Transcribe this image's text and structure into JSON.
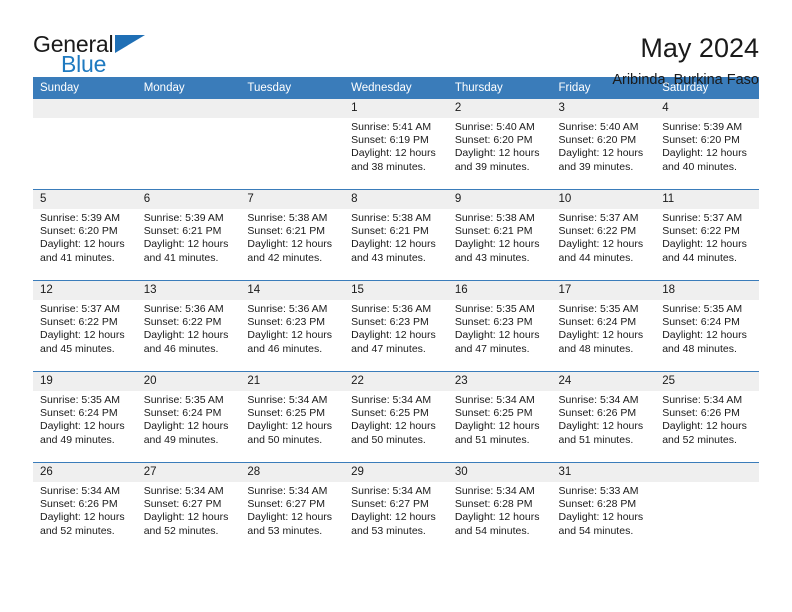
{
  "brand": {
    "name_part1": "General",
    "name_part2": "Blue",
    "triangle_icon": "triangle-icon",
    "colors": {
      "blue": "#1f7ac0",
      "dark": "#1a1a1a"
    }
  },
  "header": {
    "title": "May 2024",
    "subtitle": "Aribinda, Burkina Faso"
  },
  "calendar": {
    "accent_color": "#3a7cba",
    "daynum_band_color": "#efefef",
    "weekday_headers": [
      "Sunday",
      "Monday",
      "Tuesday",
      "Wednesday",
      "Thursday",
      "Friday",
      "Saturday"
    ],
    "weeks": [
      [
        {
          "day": "",
          "sunrise": "",
          "sunset": "",
          "daylight": "",
          "empty": true
        },
        {
          "day": "",
          "sunrise": "",
          "sunset": "",
          "daylight": "",
          "empty": true
        },
        {
          "day": "",
          "sunrise": "",
          "sunset": "",
          "daylight": "",
          "empty": true
        },
        {
          "day": "1",
          "sunrise": "Sunrise: 5:41 AM",
          "sunset": "Sunset: 6:19 PM",
          "daylight": "Daylight: 12 hours\nand 38 minutes."
        },
        {
          "day": "2",
          "sunrise": "Sunrise: 5:40 AM",
          "sunset": "Sunset: 6:20 PM",
          "daylight": "Daylight: 12 hours\nand 39 minutes."
        },
        {
          "day": "3",
          "sunrise": "Sunrise: 5:40 AM",
          "sunset": "Sunset: 6:20 PM",
          "daylight": "Daylight: 12 hours\nand 39 minutes."
        },
        {
          "day": "4",
          "sunrise": "Sunrise: 5:39 AM",
          "sunset": "Sunset: 6:20 PM",
          "daylight": "Daylight: 12 hours\nand 40 minutes."
        }
      ],
      [
        {
          "day": "5",
          "sunrise": "Sunrise: 5:39 AM",
          "sunset": "Sunset: 6:20 PM",
          "daylight": "Daylight: 12 hours\nand 41 minutes."
        },
        {
          "day": "6",
          "sunrise": "Sunrise: 5:39 AM",
          "sunset": "Sunset: 6:21 PM",
          "daylight": "Daylight: 12 hours\nand 41 minutes."
        },
        {
          "day": "7",
          "sunrise": "Sunrise: 5:38 AM",
          "sunset": "Sunset: 6:21 PM",
          "daylight": "Daylight: 12 hours\nand 42 minutes."
        },
        {
          "day": "8",
          "sunrise": "Sunrise: 5:38 AM",
          "sunset": "Sunset: 6:21 PM",
          "daylight": "Daylight: 12 hours\nand 43 minutes."
        },
        {
          "day": "9",
          "sunrise": "Sunrise: 5:38 AM",
          "sunset": "Sunset: 6:21 PM",
          "daylight": "Daylight: 12 hours\nand 43 minutes."
        },
        {
          "day": "10",
          "sunrise": "Sunrise: 5:37 AM",
          "sunset": "Sunset: 6:22 PM",
          "daylight": "Daylight: 12 hours\nand 44 minutes."
        },
        {
          "day": "11",
          "sunrise": "Sunrise: 5:37 AM",
          "sunset": "Sunset: 6:22 PM",
          "daylight": "Daylight: 12 hours\nand 44 minutes."
        }
      ],
      [
        {
          "day": "12",
          "sunrise": "Sunrise: 5:37 AM",
          "sunset": "Sunset: 6:22 PM",
          "daylight": "Daylight: 12 hours\nand 45 minutes."
        },
        {
          "day": "13",
          "sunrise": "Sunrise: 5:36 AM",
          "sunset": "Sunset: 6:22 PM",
          "daylight": "Daylight: 12 hours\nand 46 minutes."
        },
        {
          "day": "14",
          "sunrise": "Sunrise: 5:36 AM",
          "sunset": "Sunset: 6:23 PM",
          "daylight": "Daylight: 12 hours\nand 46 minutes."
        },
        {
          "day": "15",
          "sunrise": "Sunrise: 5:36 AM",
          "sunset": "Sunset: 6:23 PM",
          "daylight": "Daylight: 12 hours\nand 47 minutes."
        },
        {
          "day": "16",
          "sunrise": "Sunrise: 5:35 AM",
          "sunset": "Sunset: 6:23 PM",
          "daylight": "Daylight: 12 hours\nand 47 minutes."
        },
        {
          "day": "17",
          "sunrise": "Sunrise: 5:35 AM",
          "sunset": "Sunset: 6:24 PM",
          "daylight": "Daylight: 12 hours\nand 48 minutes."
        },
        {
          "day": "18",
          "sunrise": "Sunrise: 5:35 AM",
          "sunset": "Sunset: 6:24 PM",
          "daylight": "Daylight: 12 hours\nand 48 minutes."
        }
      ],
      [
        {
          "day": "19",
          "sunrise": "Sunrise: 5:35 AM",
          "sunset": "Sunset: 6:24 PM",
          "daylight": "Daylight: 12 hours\nand 49 minutes."
        },
        {
          "day": "20",
          "sunrise": "Sunrise: 5:35 AM",
          "sunset": "Sunset: 6:24 PM",
          "daylight": "Daylight: 12 hours\nand 49 minutes."
        },
        {
          "day": "21",
          "sunrise": "Sunrise: 5:34 AM",
          "sunset": "Sunset: 6:25 PM",
          "daylight": "Daylight: 12 hours\nand 50 minutes."
        },
        {
          "day": "22",
          "sunrise": "Sunrise: 5:34 AM",
          "sunset": "Sunset: 6:25 PM",
          "daylight": "Daylight: 12 hours\nand 50 minutes."
        },
        {
          "day": "23",
          "sunrise": "Sunrise: 5:34 AM",
          "sunset": "Sunset: 6:25 PM",
          "daylight": "Daylight: 12 hours\nand 51 minutes."
        },
        {
          "day": "24",
          "sunrise": "Sunrise: 5:34 AM",
          "sunset": "Sunset: 6:26 PM",
          "daylight": "Daylight: 12 hours\nand 51 minutes."
        },
        {
          "day": "25",
          "sunrise": "Sunrise: 5:34 AM",
          "sunset": "Sunset: 6:26 PM",
          "daylight": "Daylight: 12 hours\nand 52 minutes."
        }
      ],
      [
        {
          "day": "26",
          "sunrise": "Sunrise: 5:34 AM",
          "sunset": "Sunset: 6:26 PM",
          "daylight": "Daylight: 12 hours\nand 52 minutes."
        },
        {
          "day": "27",
          "sunrise": "Sunrise: 5:34 AM",
          "sunset": "Sunset: 6:27 PM",
          "daylight": "Daylight: 12 hours\nand 52 minutes."
        },
        {
          "day": "28",
          "sunrise": "Sunrise: 5:34 AM",
          "sunset": "Sunset: 6:27 PM",
          "daylight": "Daylight: 12 hours\nand 53 minutes."
        },
        {
          "day": "29",
          "sunrise": "Sunrise: 5:34 AM",
          "sunset": "Sunset: 6:27 PM",
          "daylight": "Daylight: 12 hours\nand 53 minutes."
        },
        {
          "day": "30",
          "sunrise": "Sunrise: 5:34 AM",
          "sunset": "Sunset: 6:28 PM",
          "daylight": "Daylight: 12 hours\nand 54 minutes."
        },
        {
          "day": "31",
          "sunrise": "Sunrise: 5:33 AM",
          "sunset": "Sunset: 6:28 PM",
          "daylight": "Daylight: 12 hours\nand 54 minutes."
        },
        {
          "day": "",
          "sunrise": "",
          "sunset": "",
          "daylight": "",
          "empty": true
        }
      ]
    ]
  }
}
